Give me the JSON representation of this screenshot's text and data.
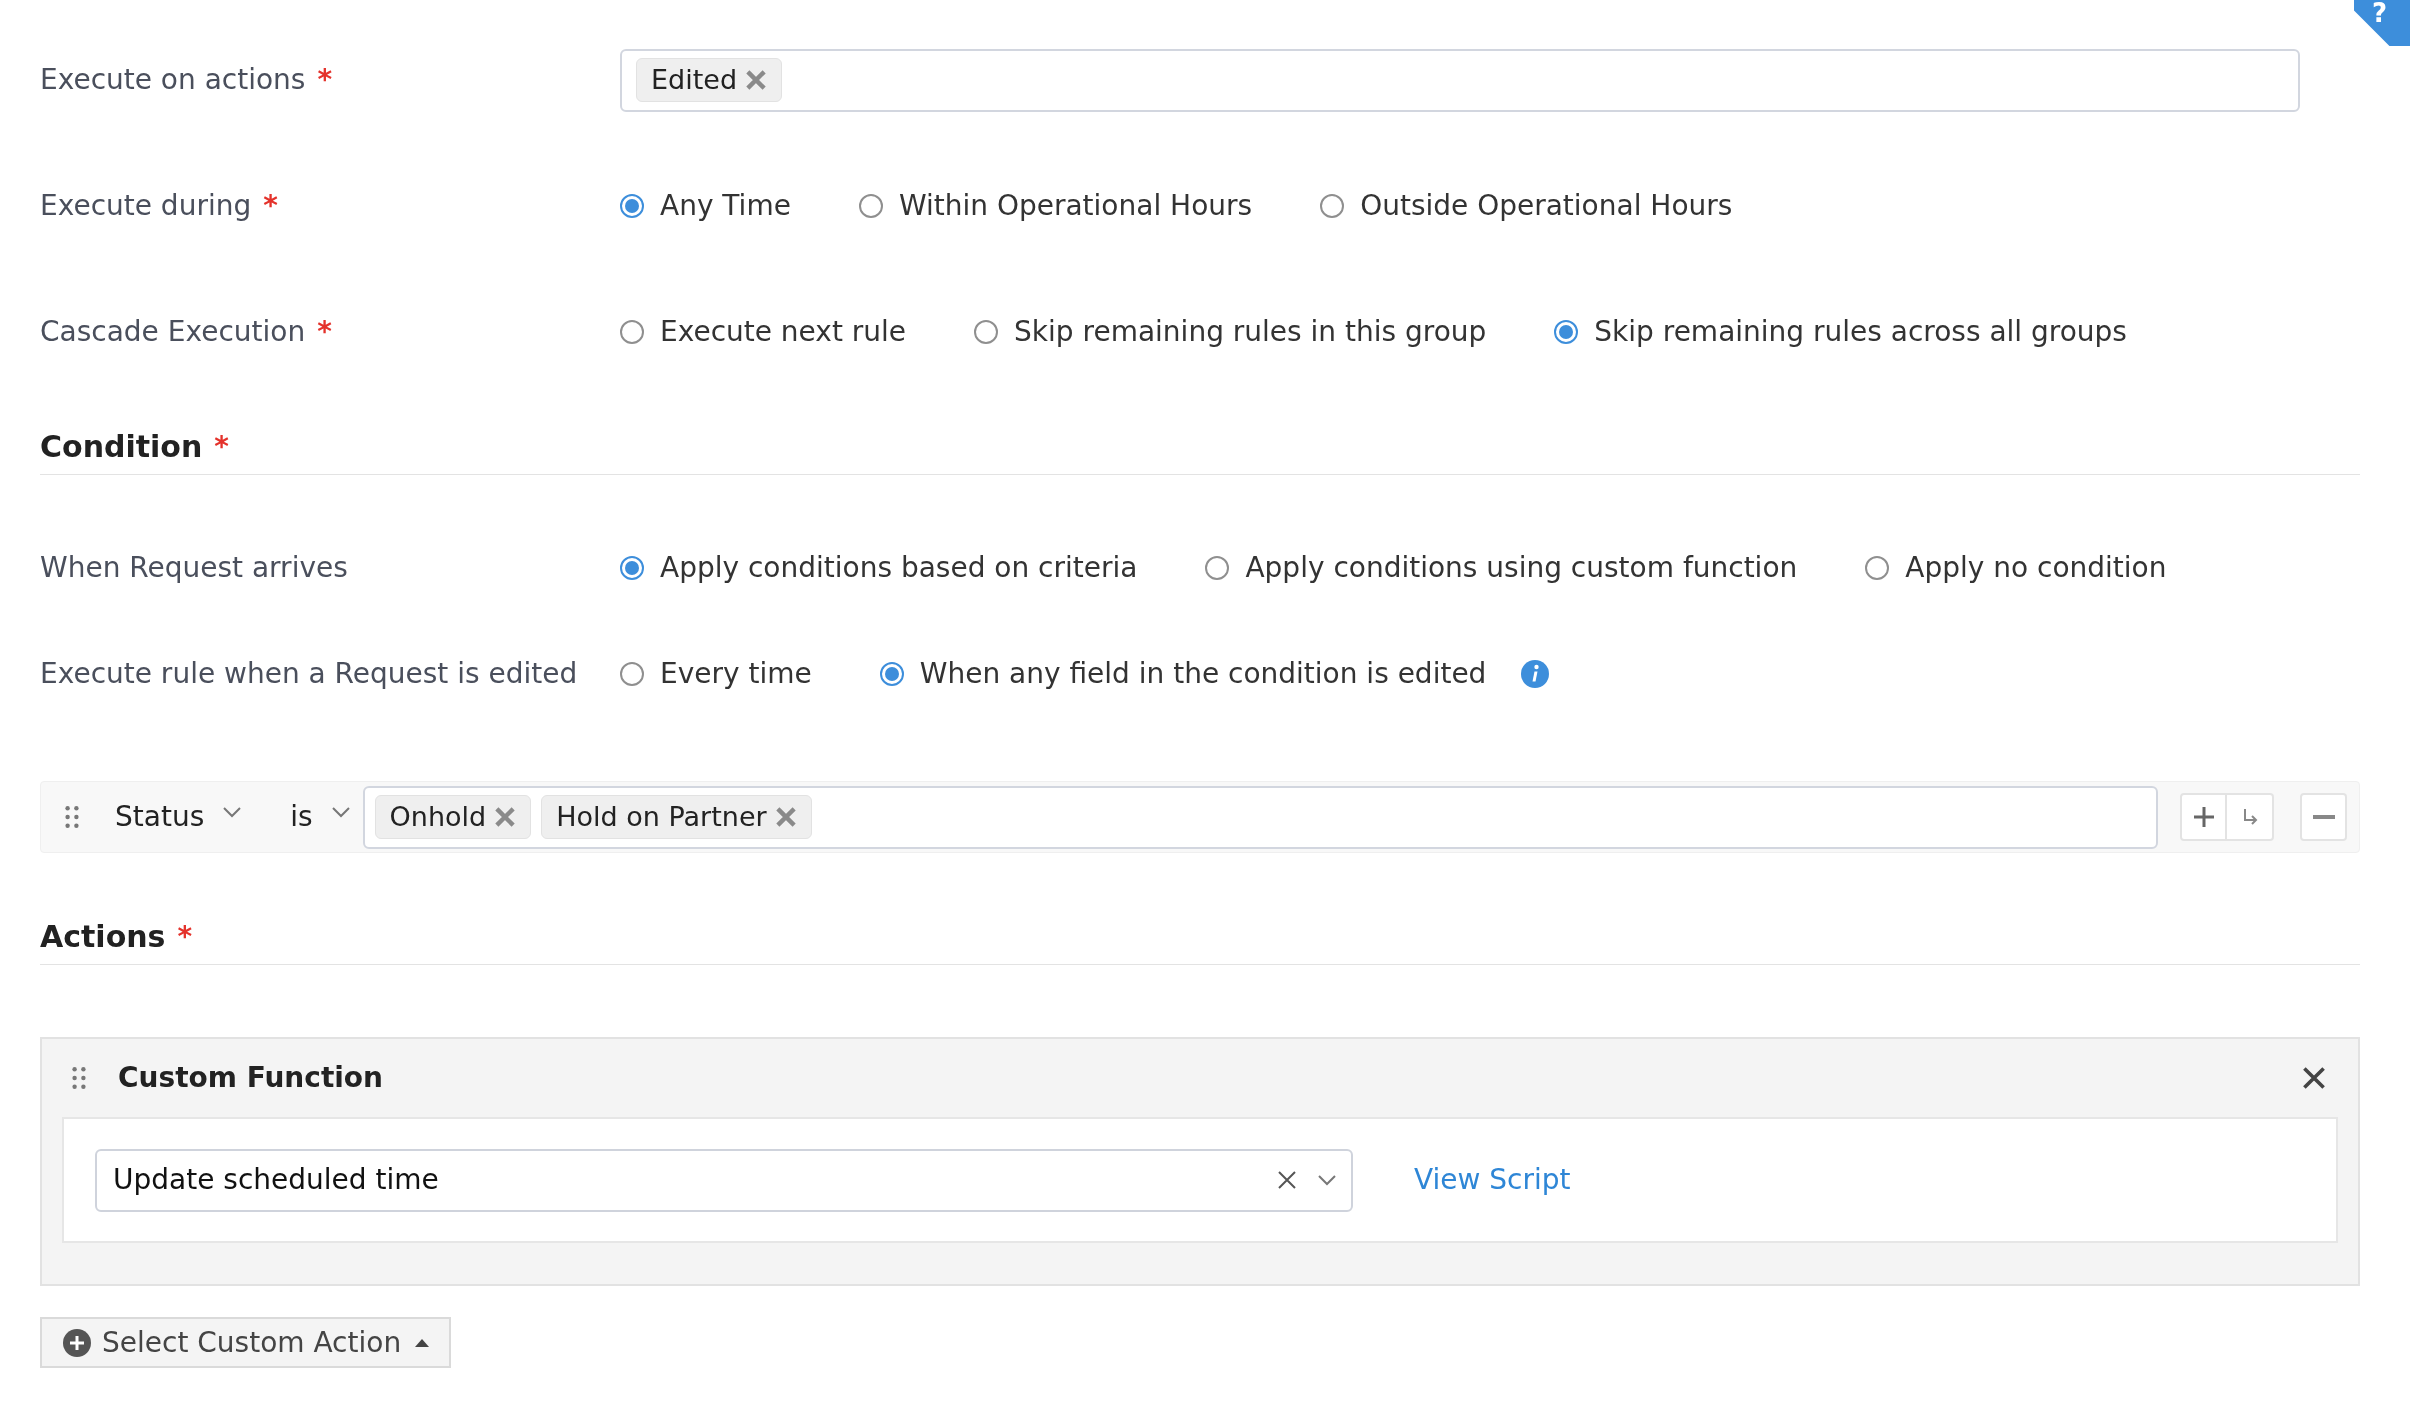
{
  "help_badge": "?",
  "fields": [
    {
      "label": "Execute on actions",
      "required_mark": "*",
      "kind": "tags",
      "tags": [
        "Edited"
      ]
    },
    {
      "label": "Execute during",
      "required_mark": "*",
      "kind": "radio",
      "options": [
        {
          "label": "Any Time",
          "selected": true
        },
        {
          "label": "Within Operational Hours",
          "selected": false
        },
        {
          "label": "Outside Operational Hours",
          "selected": false
        }
      ]
    },
    {
      "label": "Cascade Execution",
      "required_mark": "*",
      "kind": "radio",
      "options": [
        {
          "label": "Execute next rule",
          "selected": false
        },
        {
          "label": "Skip remaining rules in this group",
          "selected": false
        },
        {
          "label": "Skip remaining rules across all groups",
          "selected": true
        }
      ]
    }
  ],
  "condition": {
    "title": "Condition",
    "required_mark": "*",
    "fields": [
      {
        "label": "When Request arrives",
        "kind": "radio",
        "options": [
          {
            "label": "Apply conditions based on criteria",
            "selected": true
          },
          {
            "label": "Apply conditions using custom function",
            "selected": false
          },
          {
            "label": "Apply no condition",
            "selected": false
          }
        ]
      },
      {
        "label": "Execute rule when a Request is edited",
        "kind": "radio",
        "info": true,
        "options": [
          {
            "label": "Every time",
            "selected": false
          },
          {
            "label": "When any field in the condition is edited",
            "selected": true
          }
        ]
      }
    ],
    "criteria": {
      "field": "Status",
      "operator": "is",
      "values": [
        "Onhold",
        "Hold on Partner"
      ]
    }
  },
  "actions": {
    "title": "Actions",
    "required_mark": "*",
    "card": {
      "title": "Custom Function",
      "value": "Update scheduled time",
      "link": "View Script"
    }
  },
  "add_button": "Select Custom Action"
}
